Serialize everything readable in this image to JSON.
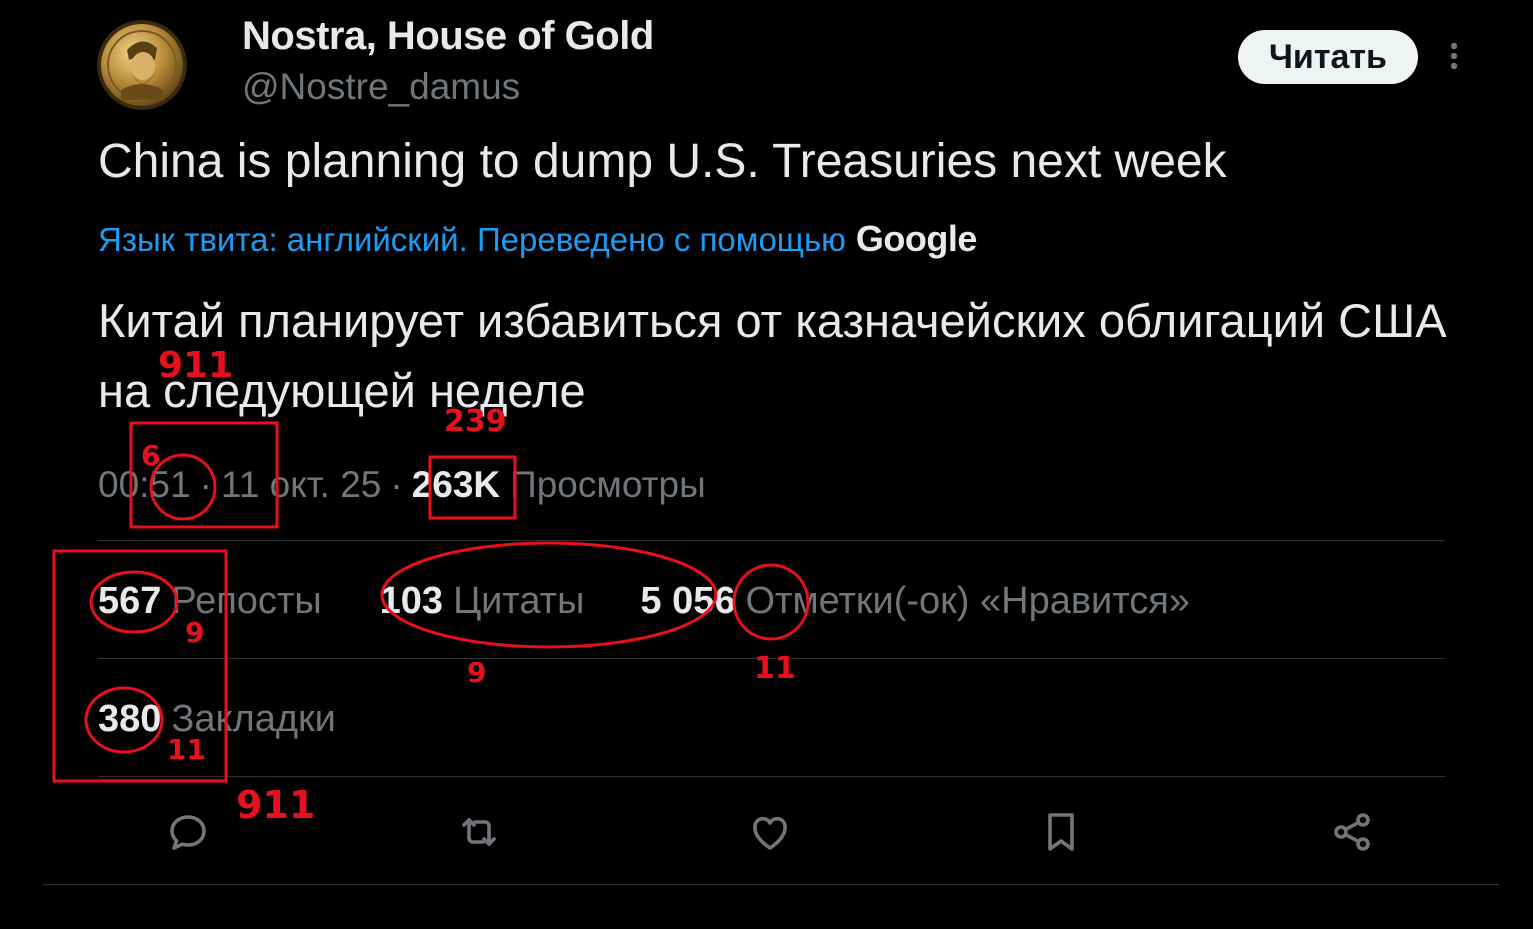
{
  "author": {
    "display_name": "Nostra, House of Gold",
    "handle": "@Nostre_damus",
    "avatar_icon": "gold-coin-portrait-avatar"
  },
  "follow_button": {
    "label": "Читать"
  },
  "tweet": {
    "text": "China is planning to dump U.S. Treasuries next week",
    "translation_label": "Язык твита: английский. Переведено с помощью",
    "translation_provider": "Google",
    "translated_text": "Китай планирует избавиться от казначейских облигаций США на следующей неделе"
  },
  "meta": {
    "time": "00:51",
    "separator": "·",
    "date": "11 окт. 25",
    "views_count": "263K",
    "views_label": "Просмотры"
  },
  "stats": {
    "reposts": {
      "count": "567",
      "label": "Репосты"
    },
    "quotes": {
      "count": "103",
      "label": "Цитаты"
    },
    "likes": {
      "count": "5 056",
      "label": "Отметки(-ок) «Нравится»"
    },
    "bookmarks": {
      "count": "380",
      "label": "Закладки"
    }
  },
  "actions": [
    "reply-icon",
    "retweet-icon",
    "like-icon",
    "bookmark-icon",
    "share-icon"
  ],
  "annotations": {
    "color": "#e8101c",
    "labels": [
      "911",
      "239",
      "6",
      "9",
      "9",
      "11",
      "11",
      "911"
    ]
  },
  "colors": {
    "background": "#000000",
    "primary_text": "#e7e9ea",
    "secondary_text": "#71767b",
    "link": "#1d9bf0",
    "divider": "#2f3336",
    "annotation": "#e8101c"
  }
}
